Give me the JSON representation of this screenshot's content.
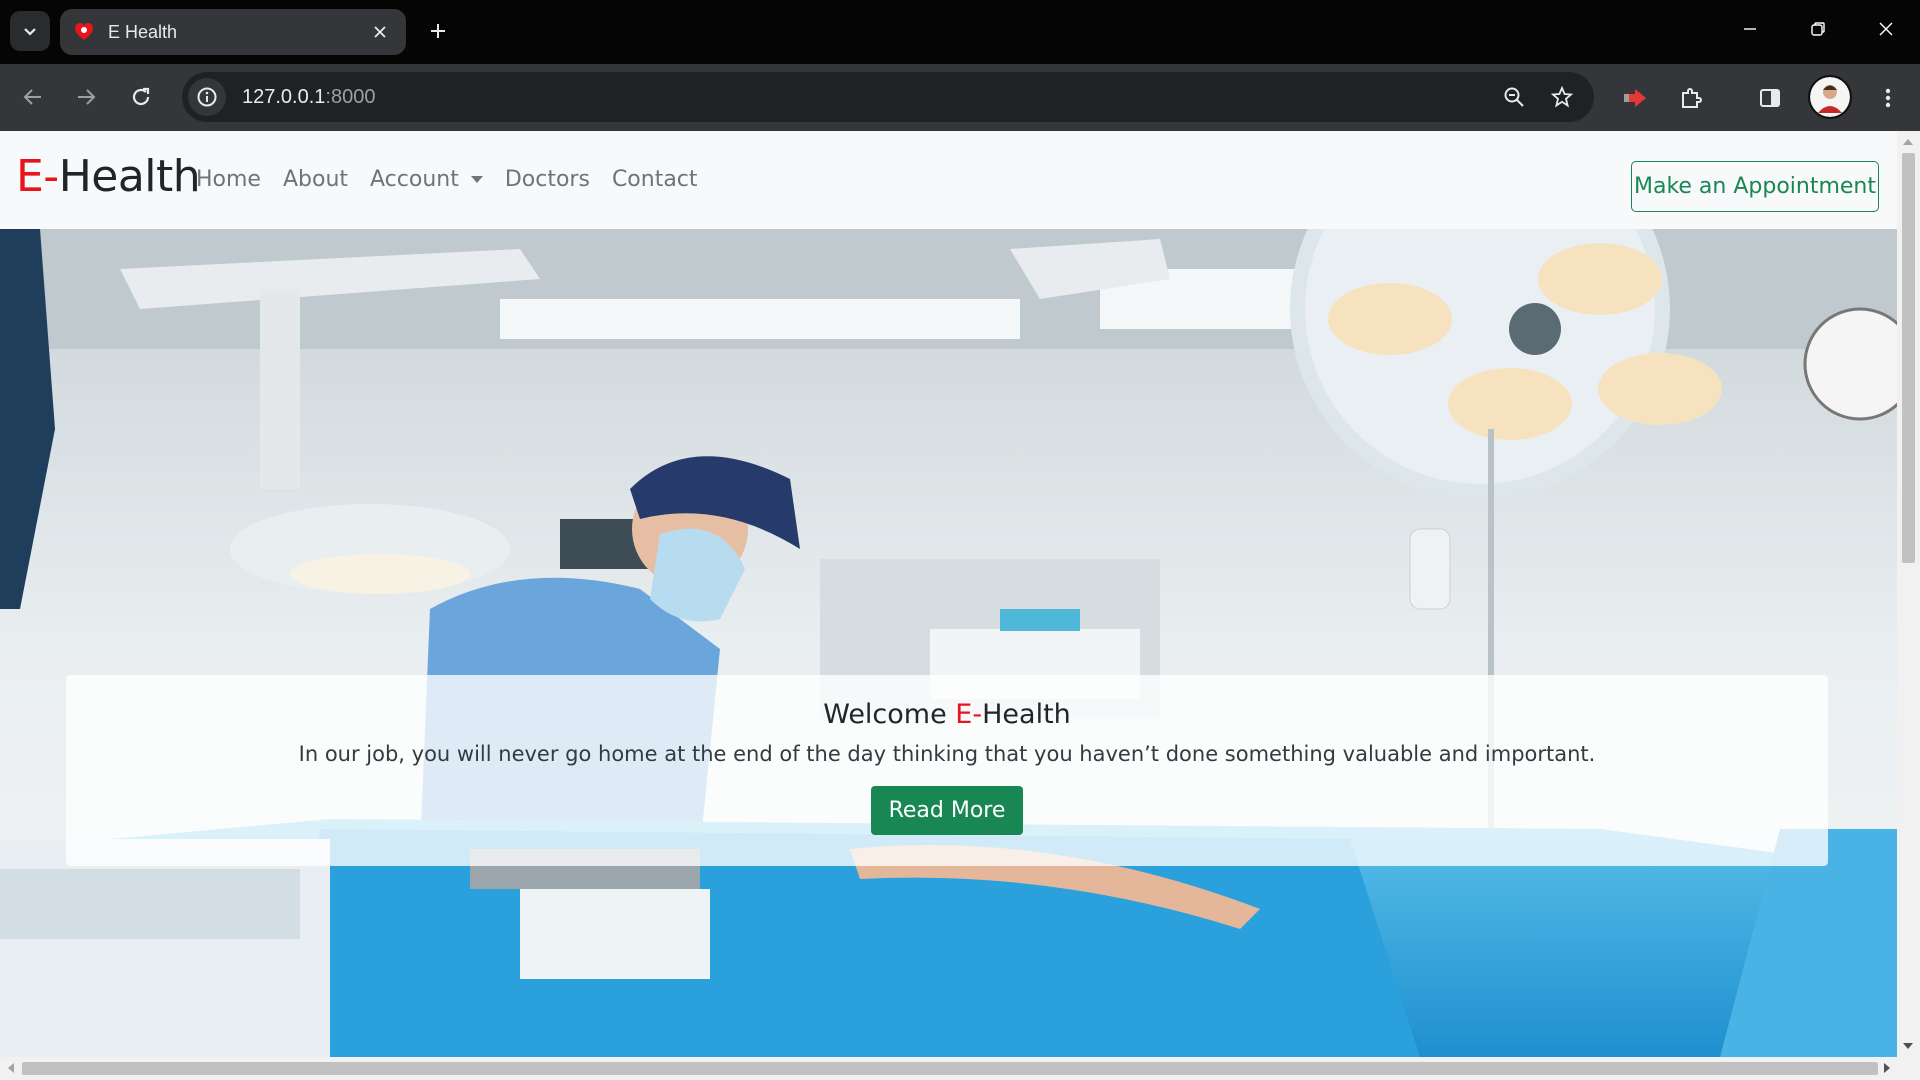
{
  "browser": {
    "tab_title": "E Health",
    "url_host": "127.0.0.1",
    "url_port": ":8000"
  },
  "site": {
    "brand_accent": "E-",
    "brand_rest": "Health",
    "nav": {
      "home": "Home",
      "about": "About",
      "account": "Account",
      "doctors": "Doctors",
      "contact": "Contact"
    },
    "appointment_button": "Make an Appointment"
  },
  "hero": {
    "title_prefix": "Welcome ",
    "title_accent": "E-",
    "title_rest": "Health",
    "text": "In our job, you will never go home at the end of the day thinking that you haven’t done something valuable and important.",
    "button": "Read More",
    "image_subject": "operating-room-surgeon-photo"
  },
  "colors": {
    "brand_red": "#e8141b",
    "success_green": "#198754",
    "nav_bg": "#f8f9fa"
  }
}
